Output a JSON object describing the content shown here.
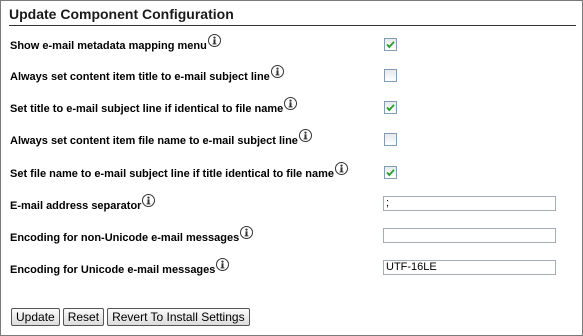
{
  "panel": {
    "title": "Update Component Configuration"
  },
  "settings": [
    {
      "label": "Show e-mail metadata mapping menu",
      "type": "checkbox",
      "checked": true
    },
    {
      "label": "Always set content item title to e-mail subject line",
      "type": "checkbox",
      "checked": false
    },
    {
      "label": "Set title to e-mail subject line if identical to file name",
      "type": "checkbox",
      "checked": true
    },
    {
      "label": "Always set content item file name to e-mail subject line",
      "type": "checkbox",
      "checked": false
    },
    {
      "label": "Set file name to e-mail subject line if title identical to file name",
      "type": "checkbox",
      "checked": true
    },
    {
      "label": "E-mail address separator",
      "type": "text",
      "value": ";"
    },
    {
      "label": "Encoding for non-Unicode e-mail messages",
      "type": "text",
      "value": ""
    },
    {
      "label": "Encoding for Unicode e-mail messages",
      "type": "text",
      "value": "UTF-16LE"
    }
  ],
  "buttons": {
    "update": "Update",
    "reset": "Reset",
    "revert": "Revert To Install Settings"
  },
  "icons": {
    "info": "info-icon",
    "check": "checkmark-icon"
  }
}
